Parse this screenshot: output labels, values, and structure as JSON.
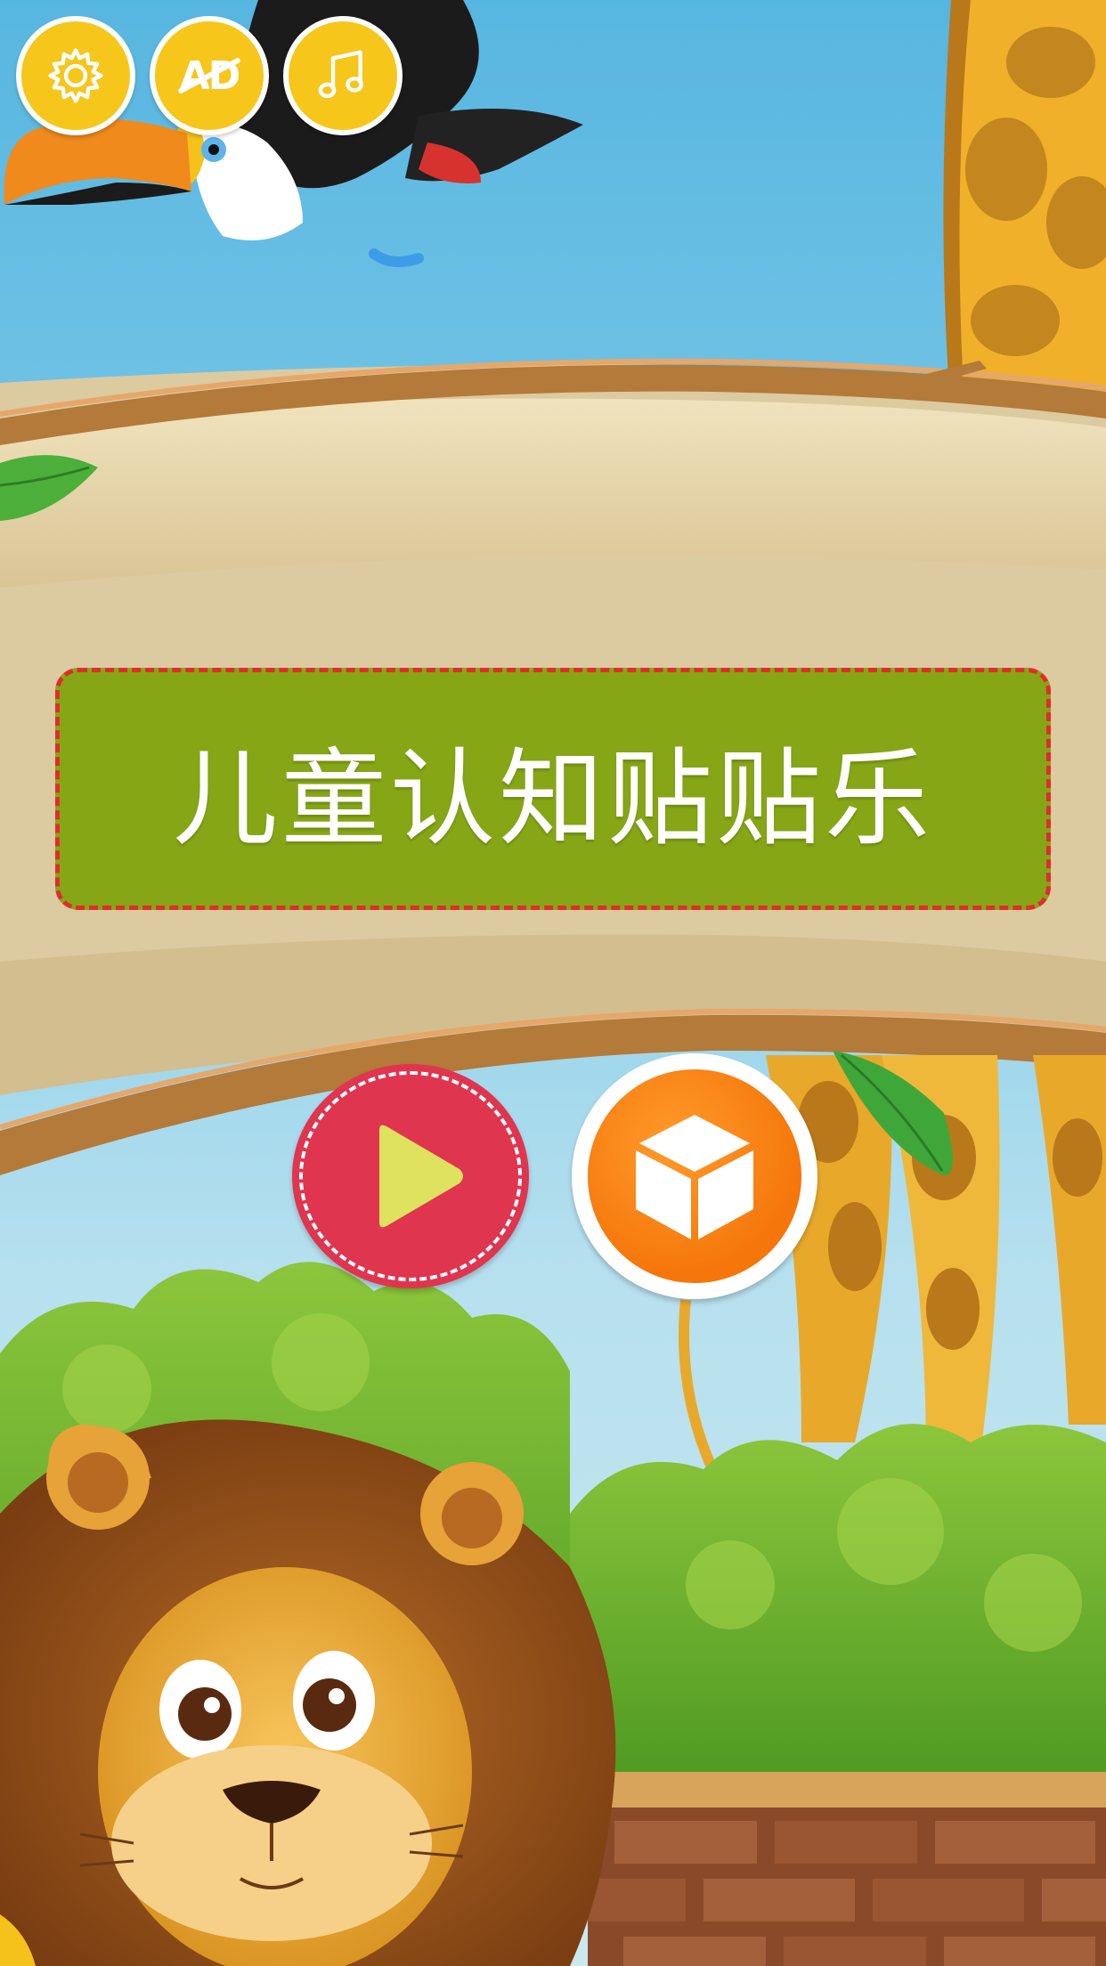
{
  "app": {
    "title": "儿童认知贴贴乐"
  },
  "toolbar": {
    "settings_icon": "gear-icon",
    "ad_label": "AD",
    "music_icon": "music-note-icon"
  },
  "main": {
    "play_icon": "play-icon",
    "cube_icon": "cube-icon"
  },
  "colors": {
    "toolbar_button": "#f6c61a",
    "title_plaque": "#86a616",
    "title_border": "#e22c2c",
    "play_button": "#e0354f",
    "cube_button": "#f5760a"
  }
}
